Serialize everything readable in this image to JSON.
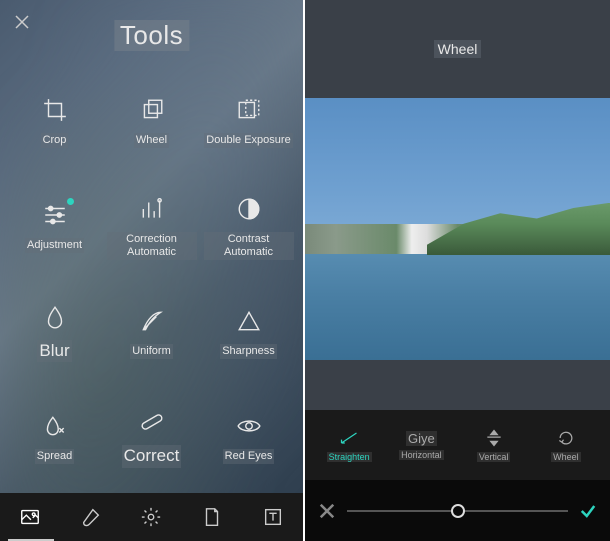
{
  "left": {
    "title": "Tools",
    "tools": [
      {
        "name": "crop",
        "label": "Crop",
        "big": false
      },
      {
        "name": "wheel",
        "label": "Wheel",
        "big": false
      },
      {
        "name": "double-exposure",
        "label": "Double Exposure",
        "big": false
      },
      {
        "name": "adjustment",
        "label": "Adjustment",
        "big": false,
        "dot": true
      },
      {
        "name": "correction-automatic",
        "label": "Correction Automatic",
        "big": false
      },
      {
        "name": "contrast-automatic",
        "label": "Contrast Automatic",
        "big": false
      },
      {
        "name": "blur",
        "label": "Blur",
        "big": true
      },
      {
        "name": "uniform",
        "label": "Uniform",
        "big": false
      },
      {
        "name": "sharpness",
        "label": "Sharpness",
        "big": false
      },
      {
        "name": "spread",
        "label": "Spread",
        "big": false
      },
      {
        "name": "correct",
        "label": "Correct",
        "big": true
      },
      {
        "name": "red-eyes",
        "label": "Red Eyes",
        "big": false
      }
    ],
    "bottom": [
      {
        "name": "photo-icon"
      },
      {
        "name": "brush-icon"
      },
      {
        "name": "settings-icon"
      },
      {
        "name": "document-icon"
      },
      {
        "name": "text-icon"
      }
    ]
  },
  "right": {
    "title": "Wheel",
    "tabs": [
      {
        "name": "straighten",
        "label": "Straighten",
        "active": true
      },
      {
        "name": "horizontal",
        "label": "Horizontal",
        "big_label": "Giye"
      },
      {
        "name": "vertical",
        "label": "Vertical"
      },
      {
        "name": "wheel",
        "label": "Wheel"
      }
    ],
    "slider": {
      "value": 50,
      "min": 0,
      "max": 100
    }
  }
}
